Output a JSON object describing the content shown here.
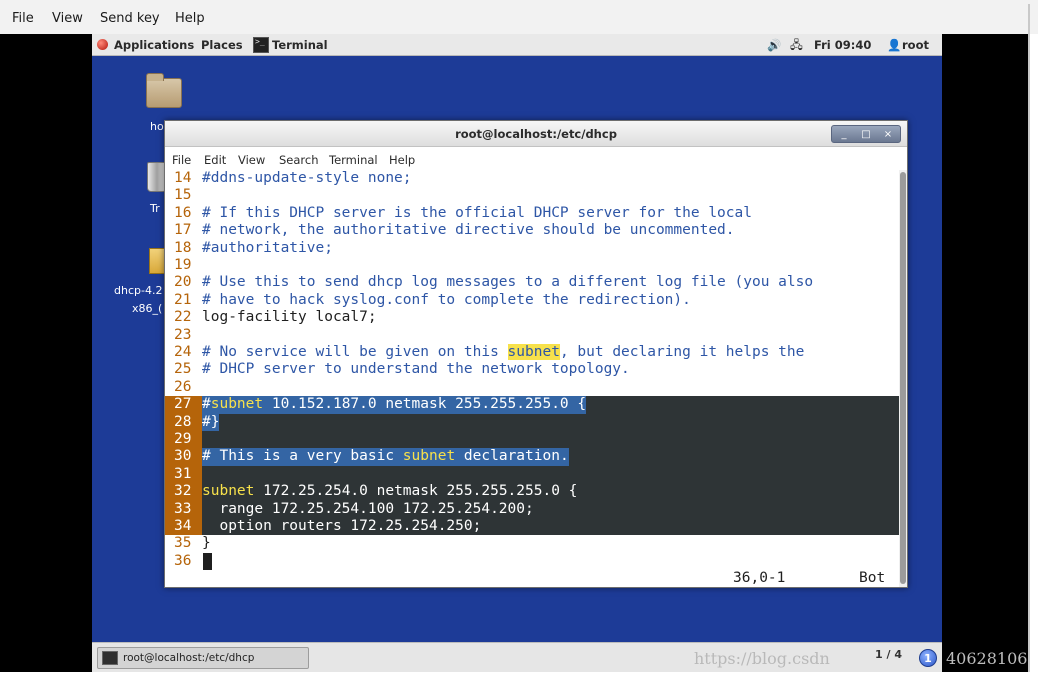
{
  "viewer_menu": [
    "File",
    "View",
    "Send key",
    "Help"
  ],
  "top_panel": {
    "applications": "Applications",
    "places": "Places",
    "terminal": "Terminal",
    "clock": "Fri 09:40",
    "user": "root"
  },
  "desktop": {
    "home_label": "ho",
    "trash_label": "Tr",
    "file_label_1": "dhcp-4.2",
    "file_label_2": "x86_("
  },
  "terminal": {
    "title": "root@localhost:/etc/dhcp",
    "menu": [
      "File",
      "Edit",
      "View",
      "Search",
      "Terminal",
      "Help"
    ],
    "window_buttons": [
      "_",
      "□",
      "×"
    ],
    "lines": [
      {
        "n": "14",
        "t": "#ddns-update-style none;"
      },
      {
        "n": "15",
        "t": ""
      },
      {
        "n": "16",
        "t": "# If this DHCP server is the official DHCP server for the local"
      },
      {
        "n": "17",
        "t": "# network, the authoritative directive should be uncommented."
      },
      {
        "n": "18",
        "t": "#authoritative;"
      },
      {
        "n": "19",
        "t": ""
      },
      {
        "n": "20",
        "t": "# Use this to send dhcp log messages to a different log file (you also"
      },
      {
        "n": "21",
        "t": "# have to hack syslog.conf to complete the redirection)."
      },
      {
        "n": "22",
        "t": "log-facility local7;"
      },
      {
        "n": "23",
        "t": ""
      },
      {
        "n": "24",
        "t_pre": "# No service will be given on this ",
        "t_hl": "subnet",
        "t_post": ", but declaring it helps the"
      },
      {
        "n": "25",
        "t": "# DHCP server to understand the network topology."
      },
      {
        "n": "26",
        "t": ""
      },
      {
        "n": "27",
        "t_pre": "#",
        "t_hl": "subnet",
        "t_post": " 10.152.187.0 netmask 255.255.255.0 {"
      },
      {
        "n": "28",
        "t": "#}"
      },
      {
        "n": "29",
        "t": ""
      },
      {
        "n": "30",
        "t_pre": "# This is a very basic ",
        "t_hl": "subnet",
        "t_post": " declaration."
      },
      {
        "n": "31",
        "t": ""
      },
      {
        "n": "32",
        "t_hl": "subnet",
        "t_post": " 172.25.254.0 netmask 255.255.255.0 {"
      },
      {
        "n": "33",
        "t": "  range 172.25.254.100 172.25.254.200;"
      },
      {
        "n": "34",
        "t": "  option routers 172.25.254.250;"
      },
      {
        "n": "35",
        "t": "}"
      },
      {
        "n": "36",
        "t": ""
      }
    ],
    "status_position": "36,0-1",
    "status_scroll": "Bot"
  },
  "bottom_panel": {
    "task_label": "root@localhost:/etc/dhcp",
    "pager": "1 / 4",
    "badge": "1"
  },
  "watermark": "https://blog.csdn",
  "watermark_suffix": "40628106",
  "colors": {
    "desktop": "#1d3b97",
    "comment": "#2e56a6",
    "line_number": "#b5640a",
    "selection": "#3465a4",
    "search_highlight": "#f7e14b",
    "dark_band": "#2e3436"
  }
}
